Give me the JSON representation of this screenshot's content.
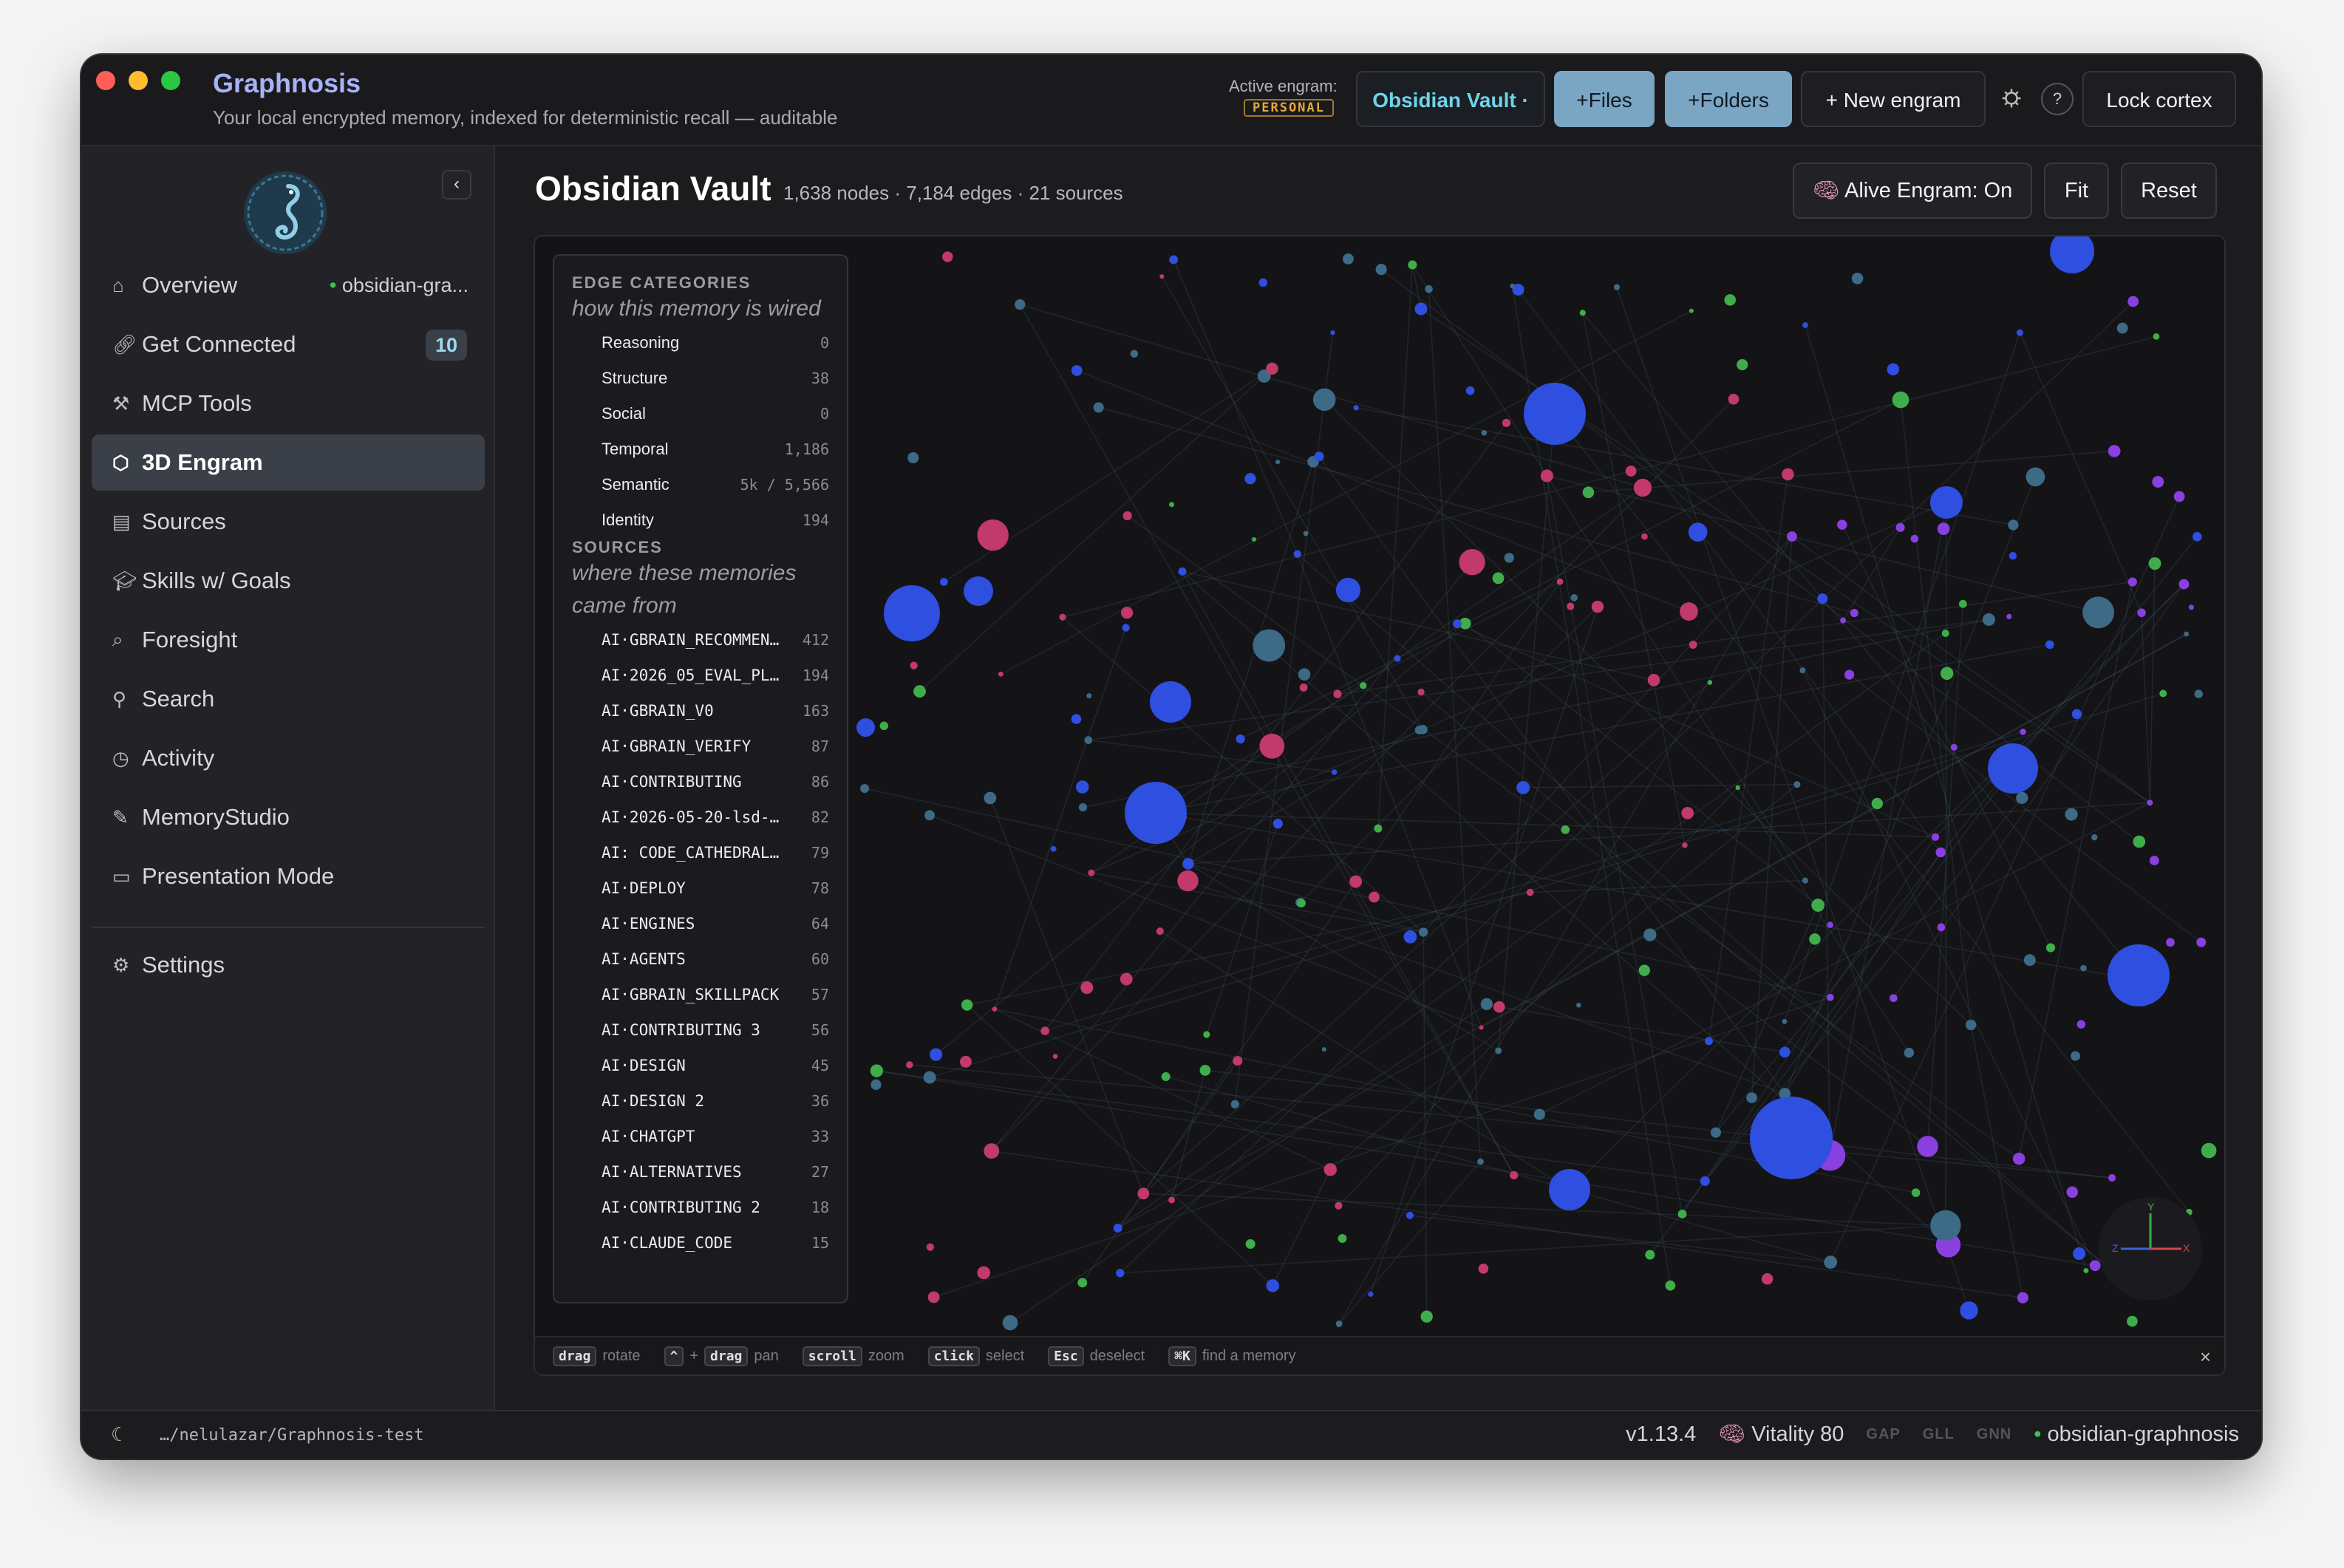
{
  "app": {
    "title": "Graphnosis",
    "subtitle": "Your local encrypted memory, indexed for deterministic recall — auditable"
  },
  "titlebar": {
    "active_label": "Active engram:",
    "active_badge": "PERSONAL",
    "vault_button": "Obsidian Vault ·",
    "files_button": "+Files",
    "folders_button": "+Folders",
    "new_engram_button": "+ New engram",
    "help_button": "?",
    "lock_button": "Lock cortex"
  },
  "sidebar": {
    "items": [
      {
        "label": "Overview",
        "icon": "home-icon",
        "extra": "obsidian-gra..."
      },
      {
        "label": "Get Connected",
        "icon": "link-icon",
        "badge": "10"
      },
      {
        "label": "MCP Tools",
        "icon": "tools-icon"
      },
      {
        "label": "3D Engram",
        "icon": "cube-icon",
        "active": true
      },
      {
        "label": "Sources",
        "icon": "document-icon"
      },
      {
        "label": "Skills w/ Goals",
        "icon": "graduation-icon"
      },
      {
        "label": "Foresight",
        "icon": "foresight-icon"
      },
      {
        "label": "Search",
        "icon": "search-icon"
      },
      {
        "label": "Activity",
        "icon": "clock-icon"
      },
      {
        "label": "MemoryStudio",
        "icon": "brush-icon"
      },
      {
        "label": "Presentation Mode",
        "icon": "monitor-icon"
      },
      {
        "label": "Settings",
        "icon": "gear-icon"
      }
    ]
  },
  "main": {
    "title": "Obsidian Vault",
    "meta": "1,638 nodes · 7,184 edges · 21 sources",
    "alive_button": "Alive Engram: On",
    "fit_button": "Fit",
    "reset_button": "Reset"
  },
  "legend": {
    "edge_head": "EDGE CATEGORIES",
    "edge_sub": "how this memory is wired",
    "edges": [
      {
        "name": "Reasoning",
        "value": "0"
      },
      {
        "name": "Structure",
        "value": "38"
      },
      {
        "name": "Social",
        "value": "0"
      },
      {
        "name": "Temporal",
        "value": "1,186"
      },
      {
        "name": "Semantic",
        "value": "5k / 5,566"
      },
      {
        "name": "Identity",
        "value": "194"
      }
    ],
    "src_head": "SOURCES",
    "src_sub": "where these memories came from",
    "sources": [
      {
        "name": "AI·GBRAIN_RECOMMEN…",
        "value": "412"
      },
      {
        "name": "AI·2026_05_EVAL_PL…",
        "value": "194"
      },
      {
        "name": "AI·GBRAIN_V0",
        "value": "163"
      },
      {
        "name": "AI·GBRAIN_VERIFY",
        "value": "87"
      },
      {
        "name": "AI·CONTRIBUTING",
        "value": "86"
      },
      {
        "name": "AI·2026-05-20-lsd-…",
        "value": "82"
      },
      {
        "name": "AI: CODE_CATHEDRAL…",
        "value": "79"
      },
      {
        "name": "AI·DEPLOY",
        "value": "78"
      },
      {
        "name": "AI·ENGINES",
        "value": "64"
      },
      {
        "name": "AI·AGENTS",
        "value": "60"
      },
      {
        "name": "AI·GBRAIN_SKILLPACK",
        "value": "57"
      },
      {
        "name": "AI·CONTRIBUTING 3",
        "value": "56"
      },
      {
        "name": "AI·DESIGN",
        "value": "45"
      },
      {
        "name": "AI·DESIGN 2",
        "value": "36"
      },
      {
        "name": "AI·CHATGPT",
        "value": "33"
      },
      {
        "name": "AI·ALTERNATIVES",
        "value": "27"
      },
      {
        "name": "AI·CONTRIBUTING 2",
        "value": "18"
      },
      {
        "name": "AI·CLAUDE_CODE",
        "value": "15"
      }
    ]
  },
  "hints": [
    {
      "keys": [
        "drag"
      ],
      "text": "rotate"
    },
    {
      "keys": [
        "^",
        "+",
        "drag"
      ],
      "text": "pan"
    },
    {
      "keys": [
        "scroll"
      ],
      "text": "zoom"
    },
    {
      "keys": [
        "click"
      ],
      "text": "select"
    },
    {
      "keys": [
        "Esc"
      ],
      "text": "deselect"
    },
    {
      "keys": [
        "⌘K"
      ],
      "text": "find a memory"
    }
  ],
  "status": {
    "path": "…/nelulazar/Graphnosis-test",
    "version": "v1.13.4",
    "vitality": "Vitality 80",
    "gap": "GAP",
    "gll": "GLL",
    "gnn": "GNN",
    "engram": "obsidian-graphnosis"
  },
  "colors": {
    "accent": "#a6b3f7",
    "node_blue": "#2f4fe0",
    "node_purple": "#8a3fe0",
    "node_pink": "#c23a6a",
    "node_green": "#3fae4a",
    "node_teal": "#3d6a86"
  }
}
